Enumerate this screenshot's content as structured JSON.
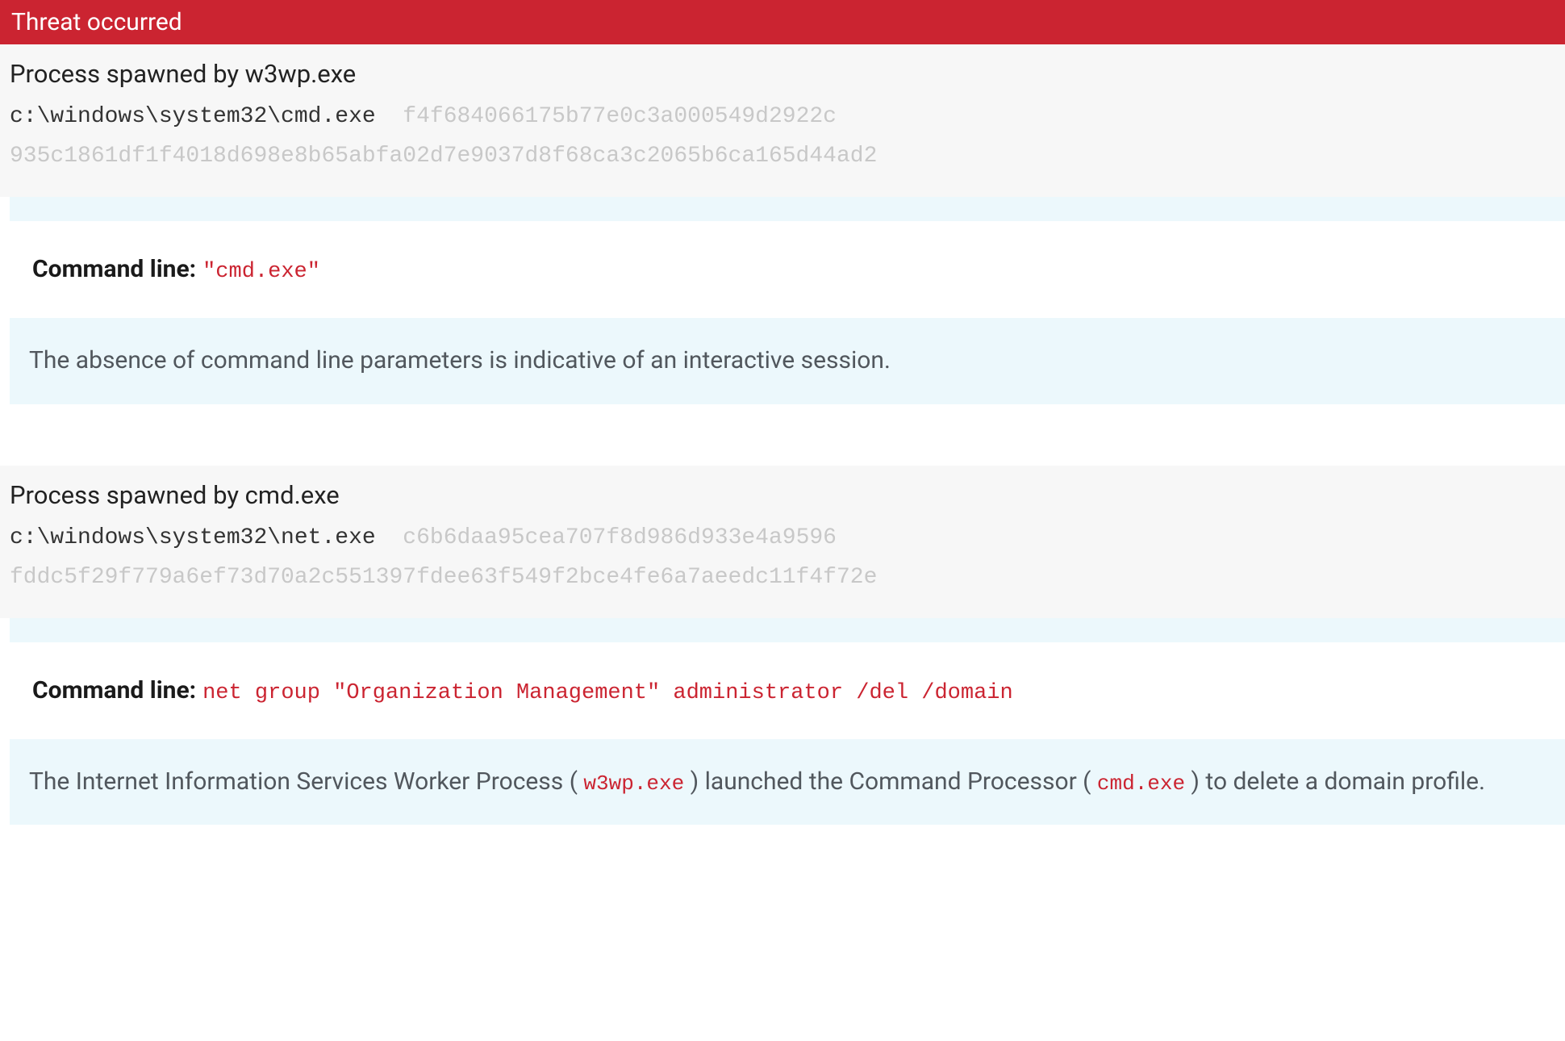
{
  "banner": {
    "title": "Threat occurred"
  },
  "processes": [
    {
      "title": "Process spawned by w3wp.exe",
      "path": "c:\\windows\\system32\\cmd.exe",
      "hash1": "f4f684066175b77e0c3a000549d2922c",
      "hash2": "935c1861df1f4018d698e8b65abfa02d7e9037d8f68ca3c2065b6ca165d44ad2",
      "cmd_label": "Command line:",
      "cmd_value": "\"cmd.exe\"",
      "description_prefix": "The absence of command line parameters is indicative of an interactive session.",
      "description_tokens": []
    },
    {
      "title": "Process spawned by cmd.exe",
      "path": "c:\\windows\\system32\\net.exe",
      "hash1": "c6b6daa95cea707f8d986d933e4a9596",
      "hash2": "fddc5f29f779a6ef73d70a2c551397fdee63f549f2bce4fe6a7aeedc11f4f72e",
      "cmd_label": "Command line:",
      "cmd_value": "net group \"Organization Management\" administrator /del /domain",
      "description_prefix": "",
      "description_tokens": [
        {
          "type": "text",
          "value": "The Internet Information Services Worker Process ( "
        },
        {
          "type": "code",
          "value": "w3wp.exe"
        },
        {
          "type": "text",
          "value": " ) launched the Command Processor ( "
        },
        {
          "type": "code",
          "value": "cmd.exe"
        },
        {
          "type": "text",
          "value": " ) to delete a domain profile."
        }
      ]
    }
  ]
}
